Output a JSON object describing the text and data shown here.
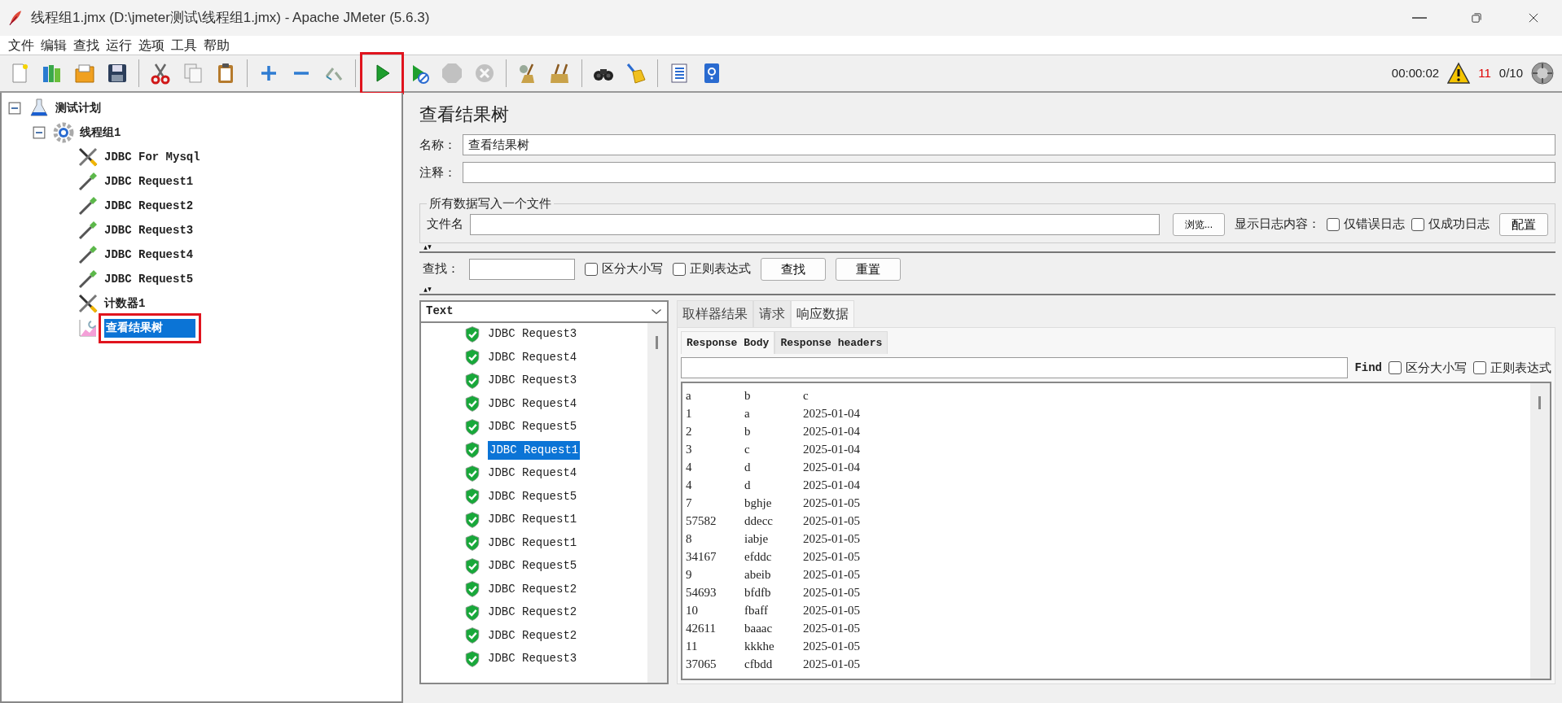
{
  "window": {
    "title": "线程组1.jmx (D:\\jmeter测试\\线程组1.jmx) - Apache JMeter (5.6.3)"
  },
  "menu": [
    "文件",
    "编辑",
    "查找",
    "运行",
    "选项",
    "工具",
    "帮助"
  ],
  "toolbar": [
    [
      {
        "kind": "new",
        "disabled": false,
        "highlighted": false
      },
      {
        "kind": "templates",
        "disabled": false,
        "highlighted": false
      },
      {
        "kind": "open",
        "disabled": false,
        "highlighted": false
      },
      {
        "kind": "save",
        "disabled": false,
        "highlighted": false
      }
    ],
    [
      {
        "kind": "cut",
        "disabled": false,
        "highlighted": false
      },
      {
        "kind": "copy",
        "disabled": false,
        "highlighted": false
      },
      {
        "kind": "paste",
        "disabled": false,
        "highlighted": false
      }
    ],
    [
      {
        "kind": "expand",
        "disabled": false,
        "highlighted": false
      },
      {
        "kind": "collapse",
        "disabled": false,
        "highlighted": false
      },
      {
        "kind": "toggle",
        "disabled": false,
        "highlighted": false
      }
    ],
    [
      {
        "kind": "start",
        "disabled": false,
        "highlighted": true
      },
      {
        "kind": "start_no_pause",
        "disabled": false,
        "highlighted": false
      },
      {
        "kind": "stop",
        "disabled": true,
        "highlighted": false
      },
      {
        "kind": "shutdown",
        "disabled": true,
        "highlighted": false
      }
    ],
    [
      {
        "kind": "clear",
        "disabled": false,
        "highlighted": false
      },
      {
        "kind": "clear_all",
        "disabled": false,
        "highlighted": false
      }
    ],
    [
      {
        "kind": "search",
        "disabled": false,
        "highlighted": false
      },
      {
        "kind": "reset_search",
        "disabled": false,
        "highlighted": false
      }
    ],
    [
      {
        "kind": "functions",
        "disabled": false,
        "highlighted": false
      },
      {
        "kind": "help",
        "disabled": false,
        "highlighted": false
      }
    ]
  ],
  "status": {
    "elapsed": "00:00:02",
    "warnings": "11",
    "threads": "0/10"
  },
  "tree": [
    {
      "label": "测试计划",
      "kind": "plan",
      "expanded": true,
      "selected": false,
      "highlighted": false,
      "children": [
        {
          "label": "线程组1",
          "kind": "threadgroup",
          "expanded": true,
          "selected": false,
          "highlighted": false,
          "children": [
            {
              "label": "JDBC For Mysql",
              "kind": "config",
              "selected": false,
              "highlighted": false
            },
            {
              "label": "JDBC Request1",
              "kind": "sampler",
              "selected": false,
              "highlighted": false
            },
            {
              "label": "JDBC Request2",
              "kind": "sampler",
              "selected": false,
              "highlighted": false
            },
            {
              "label": "JDBC Request3",
              "kind": "sampler",
              "selected": false,
              "highlighted": false
            },
            {
              "label": "JDBC Request4",
              "kind": "sampler",
              "selected": false,
              "highlighted": false
            },
            {
              "label": "JDBC Request5",
              "kind": "sampler",
              "selected": false,
              "highlighted": false
            },
            {
              "label": "计数器1",
              "kind": "config",
              "selected": false,
              "highlighted": false
            },
            {
              "label": "查看结果树",
              "kind": "listener",
              "selected": true,
              "highlighted": true
            }
          ]
        }
      ]
    }
  ],
  "panel": {
    "title": "查看结果树",
    "name_label": "名称：",
    "name_value": "查看结果树",
    "comment_label": "注释：",
    "file_group": {
      "legend": "所有数据写入一个文件",
      "file_label": "文件名",
      "browse": "浏览...",
      "log_label": "显示日志内容：",
      "checks": [
        {
          "label": "仅错误日志",
          "checked": false
        },
        {
          "label": "仅成功日志",
          "checked": false
        }
      ],
      "configure": "配置"
    },
    "search": {
      "label": "查找：",
      "checks": [
        {
          "label": "区分大小写",
          "checked": false
        },
        {
          "label": "正则表达式",
          "checked": false
        }
      ],
      "buttons": [
        "查找",
        "重置"
      ]
    },
    "renderer": "Text",
    "results": [
      {
        "label": "JDBC Request3",
        "selected": false
      },
      {
        "label": "JDBC Request4",
        "selected": false
      },
      {
        "label": "JDBC Request3",
        "selected": false
      },
      {
        "label": "JDBC Request4",
        "selected": false
      },
      {
        "label": "JDBC Request5",
        "selected": false
      },
      {
        "label": "JDBC Request1",
        "selected": true
      },
      {
        "label": "JDBC Request4",
        "selected": false
      },
      {
        "label": "JDBC Request5",
        "selected": false
      },
      {
        "label": "JDBC Request1",
        "selected": false
      },
      {
        "label": "JDBC Request1",
        "selected": false
      },
      {
        "label": "JDBC Request5",
        "selected": false
      },
      {
        "label": "JDBC Request2",
        "selected": false
      },
      {
        "label": "JDBC Request2",
        "selected": false
      },
      {
        "label": "JDBC Request2",
        "selected": false
      },
      {
        "label": "JDBC Request3",
        "selected": false
      }
    ],
    "tabs": [
      {
        "label": "取样器结果",
        "selected": false
      },
      {
        "label": "请求",
        "selected": false
      },
      {
        "label": "响应数据",
        "selected": true
      }
    ],
    "subtabs": [
      {
        "label": "Response Body",
        "selected": true
      },
      {
        "label": "Response headers",
        "selected": false
      }
    ],
    "response_find": {
      "label": "Find",
      "checks": [
        {
          "label": "区分大小写",
          "checked": false
        },
        {
          "label": "正则表达式",
          "checked": false
        }
      ]
    },
    "response_rows": [
      [
        "a",
        "b",
        "c"
      ],
      [
        "1",
        "a",
        "2025-01-04"
      ],
      [
        "2",
        "b",
        "2025-01-04"
      ],
      [
        "3",
        "c",
        "2025-01-04"
      ],
      [
        "4",
        "d",
        "2025-01-04"
      ],
      [
        "4",
        "d",
        "2025-01-04"
      ],
      [
        "7",
        "bghje",
        "2025-01-05"
      ],
      [
        "57582",
        "ddecc",
        "2025-01-05"
      ],
      [
        "8",
        "iabje",
        "2025-01-05"
      ],
      [
        "34167",
        "efddc",
        "2025-01-05"
      ],
      [
        "9",
        "abeib",
        "2025-01-05"
      ],
      [
        "54693",
        "bfdfb",
        "2025-01-05"
      ],
      [
        "10",
        "fbaff",
        "2025-01-05"
      ],
      [
        "42611",
        "baaac",
        "2025-01-05"
      ],
      [
        "11",
        "kkkhe",
        "2025-01-05"
      ],
      [
        "37065",
        "cfbdd",
        "2025-01-05"
      ]
    ]
  }
}
